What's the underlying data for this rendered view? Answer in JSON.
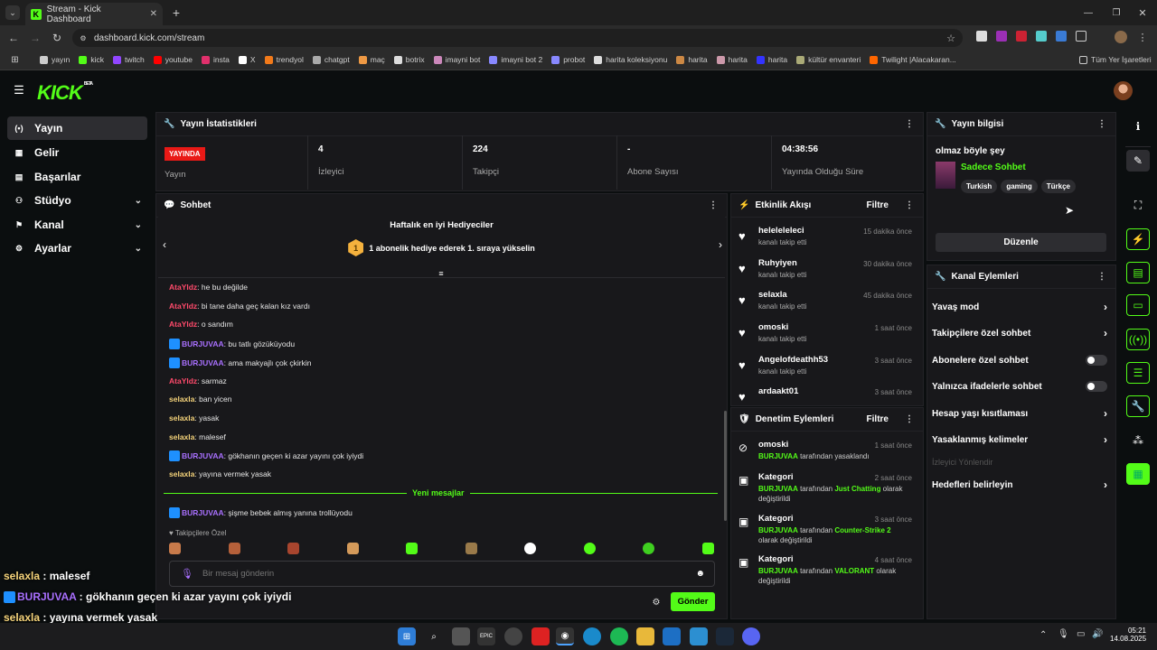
{
  "browser": {
    "tab_title": "Stream - Kick Dashboard",
    "url": "dashboard.kick.com/stream",
    "bookmarks": [
      "yayın",
      "kick",
      "twitch",
      "youtube",
      "insta",
      "X",
      "trendyol",
      "chatgpt",
      "maç",
      "botrix",
      "imayni bot",
      "imayni bot 2",
      "probot",
      "harita koleksiyonu",
      "harita",
      "harita",
      "harita",
      "kültür envanteri",
      "Twilight |Alacakaran..."
    ],
    "all_bookmarks": "Tüm Yer İşaretleri"
  },
  "app": {
    "logo": "KICK",
    "beta": "BETA"
  },
  "sidebar": {
    "items": [
      {
        "label": "Yayın",
        "icon": "broadcast-icon"
      },
      {
        "label": "Gelir",
        "icon": "revenue-icon"
      },
      {
        "label": "Başarılar",
        "icon": "achievements-icon"
      },
      {
        "label": "Stüdyo",
        "icon": "studio-icon"
      },
      {
        "label": "Kanal",
        "icon": "channel-icon"
      },
      {
        "label": "Ayarlar",
        "icon": "settings-icon"
      }
    ]
  },
  "stats": {
    "title": "Yayın İstatistikleri",
    "live_badge": "YAYINDA",
    "items": [
      {
        "value": "",
        "label": "Yayın"
      },
      {
        "value": "4",
        "label": "İzleyici"
      },
      {
        "value": "224",
        "label": "Takipçi"
      },
      {
        "value": "-",
        "label": "Abone Sayısı"
      },
      {
        "value": "04:38:56",
        "label": "Yayında Olduğu Süre"
      }
    ]
  },
  "chat": {
    "title": "Sohbet",
    "gifters_title": "Haftalık en iyi Hediyeciler",
    "gifters_rank": "1",
    "gifters_text": "1 abonelik hediye ederek 1. sıraya yükselin",
    "messages": [
      {
        "user": "AtaYldz",
        "color": "r",
        "badge": false,
        "text": "he bu değilde"
      },
      {
        "user": "AtaYldz",
        "color": "r",
        "badge": false,
        "text": "bi tane daha geç kalan kız vardı"
      },
      {
        "user": "AtaYldz",
        "color": "r",
        "badge": false,
        "text": "o sandım"
      },
      {
        "user": "BURJUVAA",
        "color": "p",
        "badge": true,
        "text": "bu tatlı gözüküyodu"
      },
      {
        "user": "BURJUVAA",
        "color": "p",
        "badge": true,
        "text": "ama makyajlı çok çkirkin"
      },
      {
        "user": "AtaYldz",
        "color": "r",
        "badge": false,
        "text": "sarmaz"
      },
      {
        "user": "selaxla",
        "color": "y",
        "badge": false,
        "text": "ban yicen"
      },
      {
        "user": "selaxla",
        "color": "y",
        "badge": false,
        "text": "yasak"
      },
      {
        "user": "selaxla",
        "color": "y",
        "badge": false,
        "text": "malesef"
      },
      {
        "user": "BURJUVAA",
        "color": "p",
        "badge": true,
        "text": "gökhanın geçen ki azar yayını çok iyiydi"
      },
      {
        "user": "selaxla",
        "color": "y",
        "badge": false,
        "text": "yayına vermek yasak"
      }
    ],
    "new_messages": "Yeni mesajlar",
    "after_new": {
      "user": "BURJUVAA",
      "text": "şişme bebek almış yanına trollüyodu"
    },
    "followers_only": "Takipçilere Özel",
    "input_placeholder": "Bir mesaj gönderin",
    "send_label": "Gönder"
  },
  "events": {
    "title": "Etkinlik Akışı",
    "filter": "Filtre",
    "items": [
      {
        "name": "heleleleleci",
        "sub": "kanalı takip etti",
        "time": "15 dakika önce"
      },
      {
        "name": "Ruhyiyen",
        "sub": "kanalı takip etti",
        "time": "30 dakika önce"
      },
      {
        "name": "selaxla",
        "sub": "kanalı takip etti",
        "time": "45 dakika önce"
      },
      {
        "name": "omoski",
        "sub": "kanalı takip etti",
        "time": "1 saat önce"
      },
      {
        "name": "Angelofdeathh53",
        "sub": "kanalı takip etti",
        "time": "3 saat önce"
      },
      {
        "name": "ardaakt01",
        "sub": "",
        "time": "3 saat önce"
      }
    ]
  },
  "moderation": {
    "title": "Denetim Eylemleri",
    "filter": "Filtre",
    "items": [
      {
        "name": "omoski",
        "time": "1 saat önce",
        "by": "BURJUVAA",
        "mid": " tarafından yasaklandı",
        "hl": "",
        "tail": ""
      },
      {
        "name": "Kategori",
        "time": "2 saat önce",
        "by": "BURJUVAA",
        "mid": " tarafından ",
        "hl": "Just Chatting",
        "tail": " olarak değiştirildi"
      },
      {
        "name": "Kategori",
        "time": "3 saat önce",
        "by": "BURJUVAA",
        "mid": " tarafından ",
        "hl": "Counter-Strike 2",
        "tail": " olarak değiştirildi"
      },
      {
        "name": "Kategori",
        "time": "4 saat önce",
        "by": "BURJUVAA",
        "mid": " tarafından ",
        "hl": "VALORANT",
        "tail": " olarak değiştirildi"
      }
    ]
  },
  "stream_info": {
    "title": "Yayın bilgisi",
    "stream_title": "olmaz böyle şey",
    "category": "Sadece Sohbet",
    "tags": [
      "Turkish",
      "gaming",
      "Türkçe"
    ],
    "edit_label": "Düzenle"
  },
  "channel_actions": {
    "title": "Kanal Eylemleri",
    "items": [
      {
        "label": "Yavaş mod",
        "kind": "arrow"
      },
      {
        "label": "Takipçilere özel sohbet",
        "kind": "arrow"
      },
      {
        "label": "Abonelere özel sohbet",
        "kind": "toggle"
      },
      {
        "label": "Yalnızca ifadelerle sohbet",
        "kind": "toggle"
      },
      {
        "label": "Hesap yaşı kısıtlaması",
        "kind": "arrow"
      },
      {
        "label": "Yasaklanmış kelimeler",
        "kind": "arrow"
      },
      {
        "label": "İzleyici Yönlendir",
        "kind": "disabled"
      },
      {
        "label": "Hedefleri belirleyin",
        "kind": "arrow"
      }
    ]
  },
  "overlay": [
    {
      "user": "selaxla",
      "text": " : malesef",
      "badge": false
    },
    {
      "user": "BURJUVAA",
      "text": " : gökhanın geçen ki azar yayını çok iyiydi",
      "badge": true
    },
    {
      "user": "selaxla",
      "text": " : yayına vermek yasak",
      "badge": false
    },
    {
      "user": "BURJUVAA",
      "text": " : şişme bebek almış yanına trollüyodu",
      "badge": true
    }
  ],
  "taskbar": {
    "time": "05:21",
    "date": "14.08.2025"
  },
  "colors": {
    "accent": "#53fc18",
    "live": "#e91916",
    "panel": "#18181b"
  }
}
